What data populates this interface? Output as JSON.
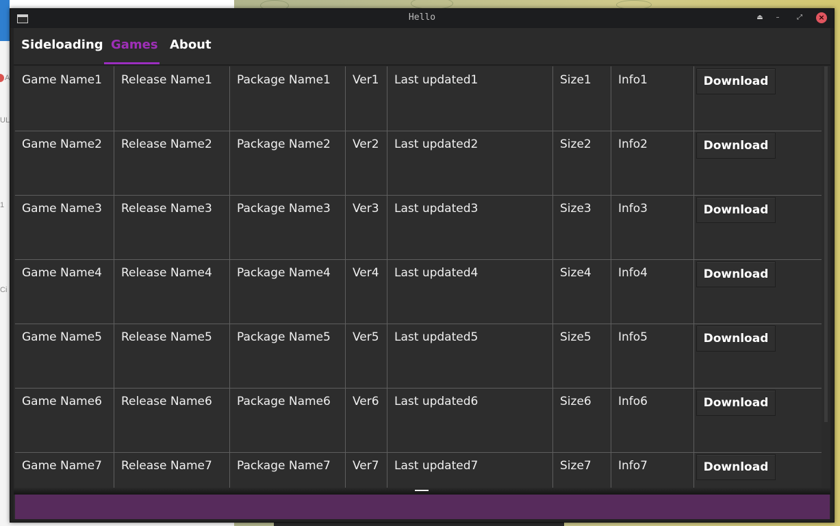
{
  "window": {
    "title": "Hello",
    "controls": [
      "eject-icon",
      "minimize-icon",
      "restore-icon",
      "close-icon"
    ],
    "control_glyphs": {
      "eject": "⏏",
      "minimize": "–",
      "restore": "⤢",
      "close": "×"
    }
  },
  "tabs": [
    {
      "label": "Sideloading",
      "active": false
    },
    {
      "label": "Games",
      "active": true
    },
    {
      "label": "About",
      "active": false
    }
  ],
  "colors": {
    "accent": "#9f2fb8",
    "bottom_panel": "#572b5c",
    "background": "#2b2b2b"
  },
  "games": {
    "download_label": "Download",
    "rows": [
      {
        "name": "Game Name1",
        "release": "Release Name1",
        "package": "Package Name1",
        "ver": "Ver1",
        "updated": "Last updated1",
        "size": "Size1",
        "info": "Info1"
      },
      {
        "name": "Game Name2",
        "release": "Release Name2",
        "package": "Package Name2",
        "ver": "Ver2",
        "updated": "Last updated2",
        "size": "Size2",
        "info": "Info2"
      },
      {
        "name": "Game Name3",
        "release": "Release Name3",
        "package": "Package Name3",
        "ver": "Ver3",
        "updated": "Last updated3",
        "size": "Size3",
        "info": "Info3"
      },
      {
        "name": "Game Name4",
        "release": "Release Name4",
        "package": "Package Name4",
        "ver": "Ver4",
        "updated": "Last updated4",
        "size": "Size4",
        "info": "Info4"
      },
      {
        "name": "Game Name5",
        "release": "Release Name5",
        "package": "Package Name5",
        "ver": "Ver5",
        "updated": "Last updated5",
        "size": "Size5",
        "info": "Info5"
      },
      {
        "name": "Game Name6",
        "release": "Release Name6",
        "package": "Package Name6",
        "ver": "Ver6",
        "updated": "Last updated6",
        "size": "Size6",
        "info": "Info6"
      },
      {
        "name": "Game Name7",
        "release": "Release Name7",
        "package": "Package Name7",
        "ver": "Ver7",
        "updated": "Last updated7",
        "size": "Size7",
        "info": "Info7"
      }
    ]
  },
  "background_fragments": [
    "A",
    "UL",
    "1",
    "Ci"
  ]
}
